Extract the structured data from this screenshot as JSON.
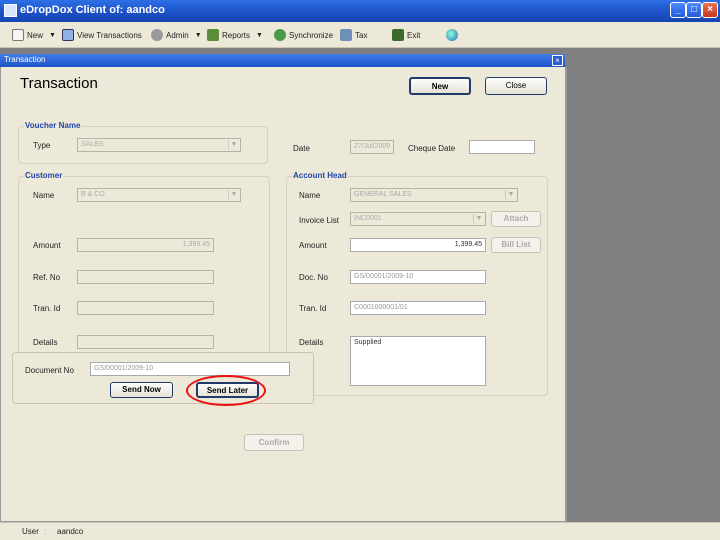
{
  "app": {
    "title": "eDropDox Client of: aandco",
    "controls": {
      "minimize": "_",
      "maximize": "□",
      "close": "×"
    }
  },
  "toolbar": {
    "items": [
      {
        "label": "New",
        "icon": "new-document-icon",
        "has_dropdown": true
      },
      {
        "label": "View Transactions",
        "icon": "view-transactions-icon",
        "has_dropdown": false
      },
      {
        "label": "Admin",
        "icon": "admin-icon",
        "has_dropdown": true
      },
      {
        "label": "Reports",
        "icon": "reports-icon",
        "has_dropdown": true
      },
      {
        "label": "Synchronize",
        "icon": "synchronize-icon",
        "has_dropdown": false
      },
      {
        "label": "Tax",
        "icon": "tax-icon",
        "has_dropdown": false
      },
      {
        "label": "Exit",
        "icon": "exit-icon",
        "has_dropdown": false
      }
    ],
    "help_icon": "globe-icon"
  },
  "window": {
    "title": "Transaction",
    "close": "×",
    "heading": "Transaction",
    "new_button": "New",
    "close_button": "Close"
  },
  "voucher": {
    "legend": "Voucher Name",
    "type_label": "Type",
    "type_value": "SALES"
  },
  "dates": {
    "date_label": "Date",
    "date_value": "27/Jul/2009",
    "cheque_label": "Cheque Date",
    "cheque_value": ""
  },
  "customer": {
    "legend": "Customer",
    "name_label": "Name",
    "name_value": "B & CO",
    "amount_label": "Amount",
    "amount_value": "1,399.45",
    "ref_label": "Ref. No",
    "ref_value": "",
    "tran_label": "Tran. Id",
    "tran_value": "",
    "details_label": "Details",
    "details_value": ""
  },
  "account_head": {
    "legend": "Account Head",
    "name_label": "Name",
    "name_value": "GENERAL SALES",
    "invoice_label": "Invoice List",
    "invoice_value": "INC0001",
    "attach_button": "Attach",
    "amount_label": "Amount",
    "amount_value": "1,399.45",
    "bill_list_button": "Bill List",
    "doc_label": "Doc. No",
    "doc_value": "GS/00001/2009-10",
    "tran_label": "Tran. Id",
    "tran_value": "C0001000001/01",
    "details_label": "Details",
    "details_value": "Supplied"
  },
  "send_panel": {
    "doc_label": "Document No",
    "doc_value": "GS/00001/2009-10",
    "send_now": "Send Now",
    "send_later": "Send Later"
  },
  "confirm_button": "Confirm",
  "status": {
    "user_label": "User",
    "user_value": "aandco"
  },
  "colors": {
    "titlebar": "#1b4fc4",
    "legend": "#2244aa",
    "highlight_ring": "#e11111",
    "window_bg": "#ece9d8"
  }
}
